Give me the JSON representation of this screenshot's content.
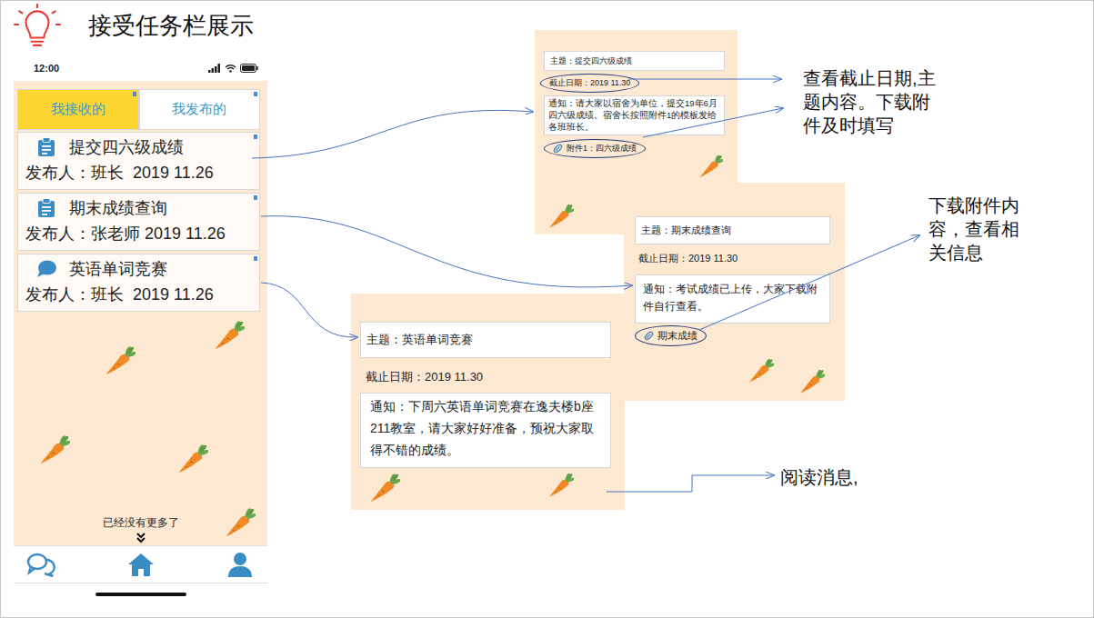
{
  "slide": {
    "title": "接受任务栏展示"
  },
  "phone": {
    "status_bar": {
      "time": "12:00"
    },
    "tabs": [
      {
        "label": "我接收的",
        "selected": true
      },
      {
        "label": "我发布的",
        "selected": false
      }
    ],
    "tasks": [
      {
        "title": "提交四六级成绩",
        "publisher": "发布人：班长  2019 11.26",
        "kind": "clipboard"
      },
      {
        "title": "期末成绩查询",
        "publisher": "发布人：张老师 2019 11.26",
        "kind": "clipboard"
      },
      {
        "title": "英语单词竞赛",
        "publisher": "发布人：班长  2019 11.26",
        "kind": "chat"
      }
    ],
    "footer": "已经没有更多了"
  },
  "details": [
    {
      "subject": "主题：提交四六级成绩",
      "deadline": "截止日期：2019 11.30",
      "deadline_circled": true,
      "notice": "通知：请大家以宿舍为单位，提交19年6月四六级成绩。宿舍长按照附件1的模板发给各班班长。",
      "attachment": "附件1：四六级成绩",
      "attachment_circled": true
    },
    {
      "subject": "主题：期末成绩查询",
      "deadline": "截止日期：2019 11.30",
      "deadline_circled": false,
      "notice": "通知：考试成绩已上传，大家下载附件自行查看。",
      "attachment": "期末成绩",
      "attachment_circled": true
    },
    {
      "subject": "主题：英语单词竞赛",
      "deadline": "截止日期：2019 11.30",
      "deadline_circled": false,
      "notice": "通知：下周六英语单词竞赛在逸夫楼b座211教室，请大家好好准备，预祝大家取得不错的成绩。"
    }
  ],
  "annotations": [
    "查看截止日期,主题内容。下载附件及时填写",
    "下载附件内容，查看相关信息",
    "阅读消息,"
  ]
}
